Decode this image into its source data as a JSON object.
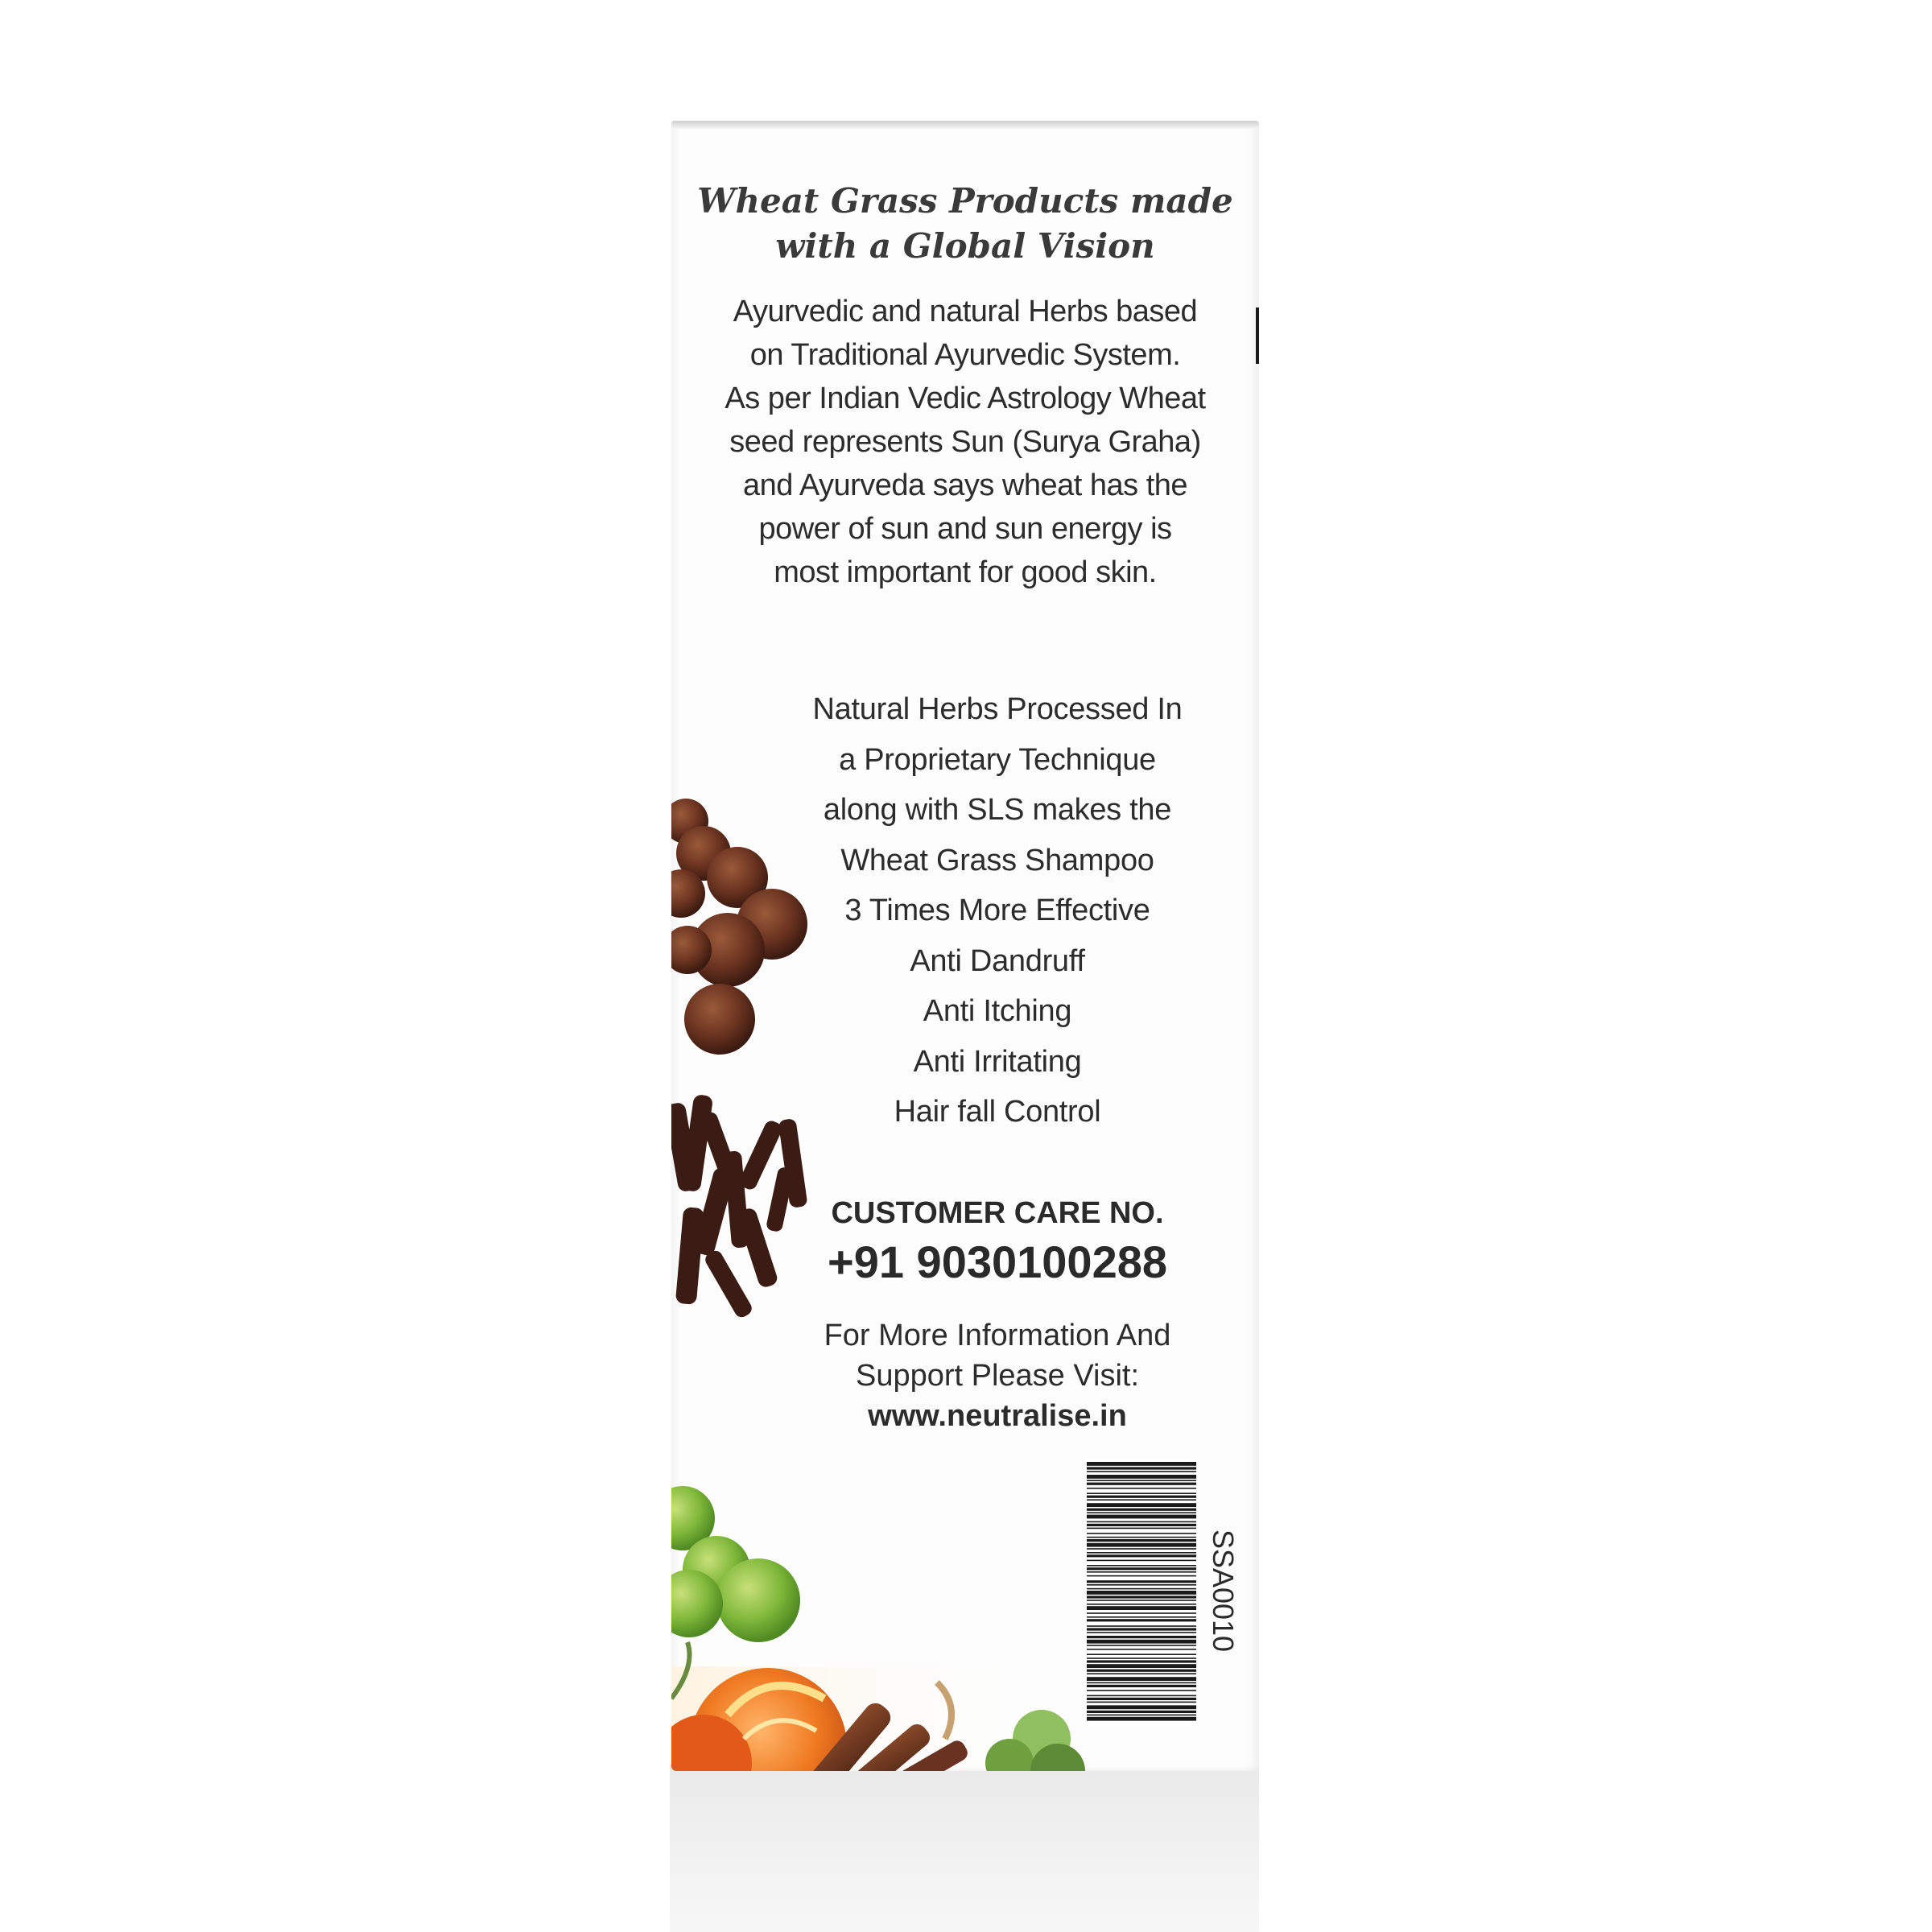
{
  "box": {
    "tagline": [
      "Wheat Grass Products made",
      "with a Global Vision"
    ],
    "intro": [
      "Ayurvedic and natural Herbs based",
      "on Traditional Ayurvedic System.",
      "As per Indian Vedic Astrology Wheat",
      "seed represents Sun (Surya Graha)",
      "and Ayurveda says wheat has the",
      "power of sun and sun energy is",
      "most important for good skin."
    ],
    "features": [
      "Natural Herbs Processed In",
      "a Proprietary Technique",
      "along with SLS makes the",
      "Wheat Grass Shampoo",
      "3 Times More Effective",
      "Anti Dandruff",
      "Anti Itching",
      "Anti Irritating",
      "Hair fall Control"
    ],
    "customer_care": {
      "label": "CUSTOMER CARE NO.",
      "phone": "+91 9030100288"
    },
    "info": {
      "line1": "For More Information And",
      "line2": "Support Please Visit:",
      "url": "www.neutralise.in"
    },
    "barcode": {
      "code": "SSA0010"
    }
  },
  "colors": {
    "background": "#ffffff",
    "box": "#fdfdfd",
    "text": "#2a2a2a"
  }
}
